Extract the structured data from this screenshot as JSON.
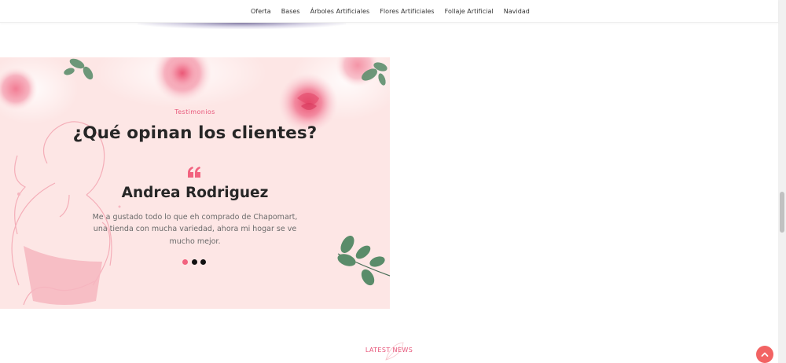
{
  "nav": {
    "items": [
      {
        "label": "Oferta"
      },
      {
        "label": "Bases"
      },
      {
        "label": "Árboles Artificiales"
      },
      {
        "label": "Flores Artificiales"
      },
      {
        "label": "Follaje Artificial"
      },
      {
        "label": "Navidad"
      }
    ]
  },
  "testimonials": {
    "kicker": "Testimonios",
    "heading": "¿Qué opinan los clientes?",
    "author": "Andrea Rodriguez",
    "review": "Me a gustado todo lo que eh comprado de Chapomart, una tienda con mucha variedad, ahora mi hogar se ve mucho mejor.",
    "slides": 3,
    "active_slide": 1
  },
  "latest_news": {
    "label": "LATEST NEWS"
  },
  "icons": {
    "quote": "quote-icon",
    "back_to_top": "chevron-up-icon"
  },
  "colors": {
    "accent": "#e7567a",
    "panel_bg": "#fde6e5",
    "heading": "#262626",
    "body_text": "#6a6a6a",
    "back_to_top": "#f26363"
  }
}
